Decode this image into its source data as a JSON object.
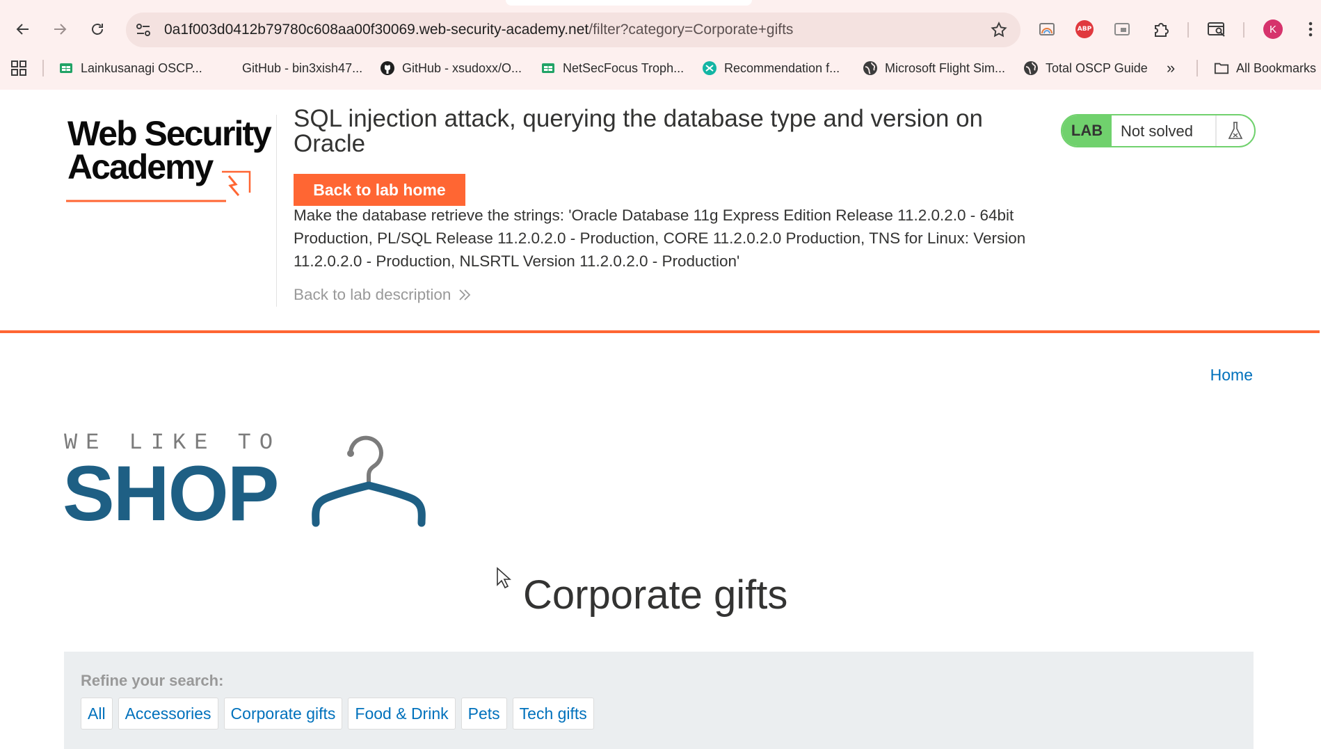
{
  "browser": {
    "url_host": "0a1f003d0412b79780c608aa00f30069.web-security-academy.net",
    "url_path": "/filter?category=Corporate+gifts",
    "profile_initial": "K",
    "abp_label": "ABP",
    "bookmarks": [
      {
        "label": "Lainkusanagi OSCP...",
        "icon": "sheets-icon"
      },
      {
        "label": "GitHub - bin3xish47...",
        "icon": "blank-page-icon"
      },
      {
        "label": "GitHub - xsudoxx/O...",
        "icon": "github-icon"
      },
      {
        "label": "NetSecFocus Troph...",
        "icon": "sheets-icon"
      },
      {
        "label": "Recommendation f...",
        "icon": "recommendation-icon"
      },
      {
        "label": "Microsoft Flight Sim...",
        "icon": "globe-icon"
      },
      {
        "label": "Total OSCP Guide",
        "icon": "globe-icon"
      }
    ],
    "more_bookmarks": "»",
    "all_bookmarks": "All Bookmarks"
  },
  "lab": {
    "logo_line1": "Web Security",
    "logo_line2": "Academy",
    "title": "SQL injection attack, querying the database type and version on Oracle",
    "back_button": "Back to lab home",
    "description": "Make the database retrieve the strings: 'Oracle Database 11g Express Edition Release 11.2.0.2.0 - 64bit Production, PL/SQL Release 11.2.0.2.0 - Production, CORE 11.2.0.2.0 Production, TNS for Linux: Version 11.2.0.2.0 - Production, NLSRTL Version 11.2.0.2.0 - Production'",
    "back_to_description": "Back to lab description",
    "status_tag": "LAB",
    "status_text": "Not solved",
    "accent_color": "#ff6633",
    "solved_green": "#70d16d"
  },
  "shop": {
    "home_link": "Home",
    "tagline": "WE LIKE TO",
    "wordmark": "SHOP",
    "heading": "Corporate gifts",
    "refine_label": "Refine your search:",
    "filters": [
      "All",
      "Accessories",
      "Corporate gifts",
      "Food & Drink",
      "Pets",
      "Tech gifts"
    ],
    "link_color": "#0071bc"
  }
}
